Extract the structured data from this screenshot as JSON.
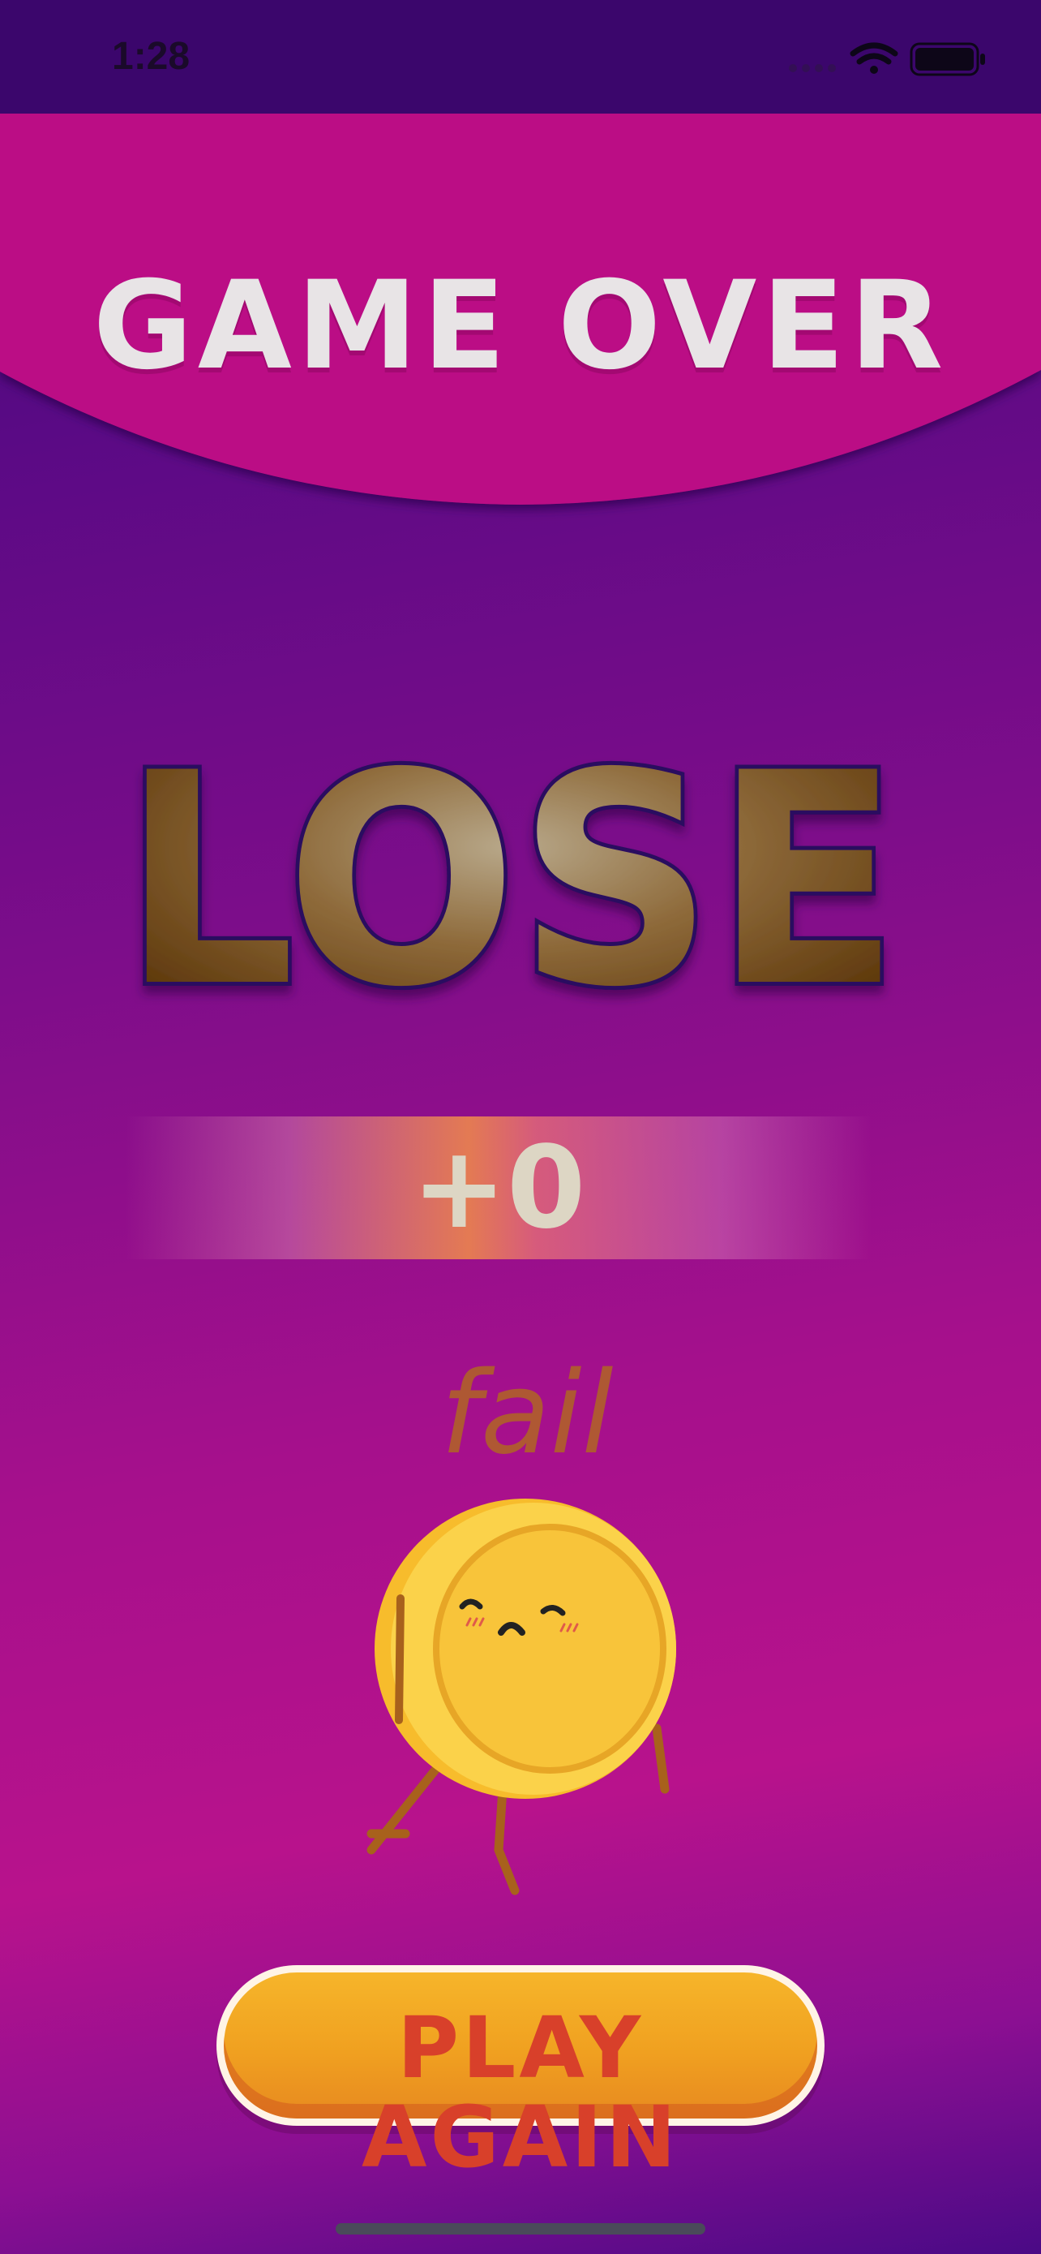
{
  "status_bar": {
    "time": "1:28",
    "icons": [
      "signal-dots-icon",
      "wifi-icon",
      "battery-icon"
    ]
  },
  "header": {
    "title": "GAME OVER",
    "color": "#bb0f85"
  },
  "result": {
    "word": "LOSE",
    "color": "#8a5a1a"
  },
  "score": {
    "value": "+0"
  },
  "mascot": {
    "caption": "fail",
    "name": "sad-coin-mascot"
  },
  "actions": {
    "play_again_label": "PLAY AGAIN"
  },
  "colors": {
    "background_top": "#3c0670",
    "background_mid": "#b8128c",
    "button_orange": "#f0a020",
    "button_text": "#d8402a"
  }
}
